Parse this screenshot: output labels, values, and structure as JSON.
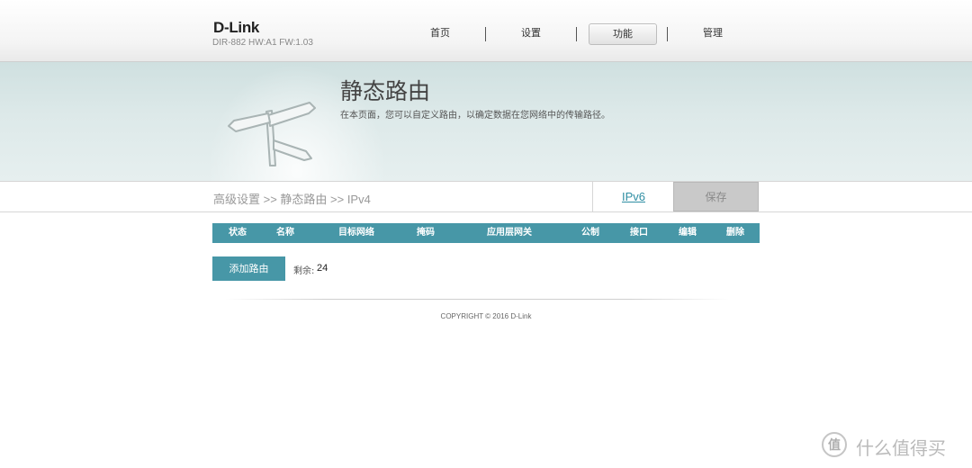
{
  "header": {
    "logo": "D-Link",
    "model": "DIR-882 HW:A1 FW:1.03",
    "nav": [
      {
        "label": "首页",
        "active": false
      },
      {
        "label": "设置",
        "active": false
      },
      {
        "label": "功能",
        "active": true
      },
      {
        "label": "管理",
        "active": false
      }
    ]
  },
  "banner": {
    "title": "静态路由",
    "description": "在本页面，您可以自定义路由，以确定数据在您网络中的传输路径。",
    "icon": "signpost-icon"
  },
  "breadcrumb": "高级设置 >> 静态路由 >> IPv4",
  "tabs": {
    "ipv6_label": "IPv6",
    "save_label": "保存"
  },
  "table": {
    "columns": [
      "状态",
      "名称",
      "目标网络",
      "掩码",
      "应用层网关",
      "公制",
      "接口",
      "编辑",
      "删除"
    ],
    "rows": []
  },
  "actions": {
    "add_label": "添加路由",
    "remaining_label": "剩余:",
    "remaining_value": "24"
  },
  "footer": {
    "copyright": "COPYRIGHT © 2016 D-Link"
  },
  "watermark": {
    "icon_glyph": "值",
    "text": "什么值得买"
  },
  "colors": {
    "accent": "#4797a7",
    "link": "#2f8ea3",
    "save_disabled": "#c9c9c9"
  }
}
